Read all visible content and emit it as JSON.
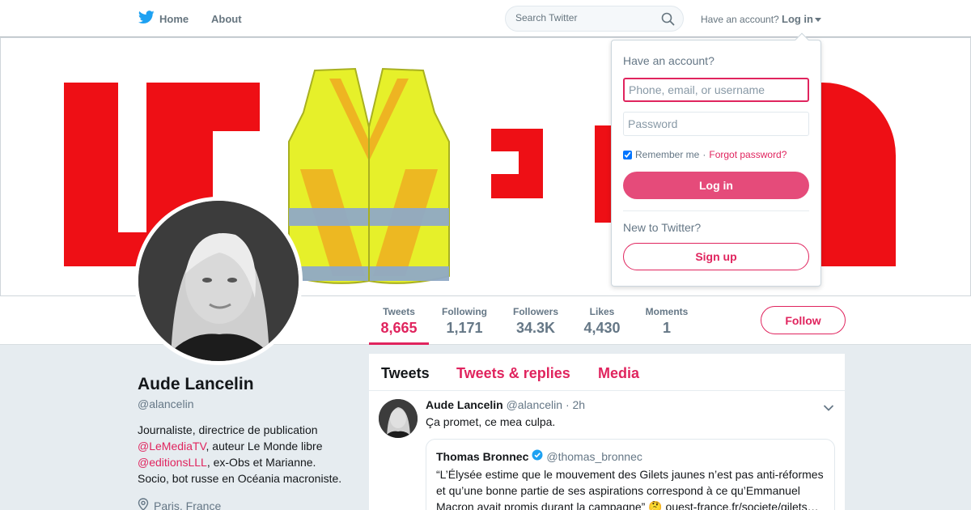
{
  "nav": {
    "home_label": "Home",
    "about_label": "About",
    "search_placeholder": "Search Twitter",
    "have_account": "Have an account?",
    "login_label": "Log in",
    "brand_color": "#1da1f2"
  },
  "login_dropdown": {
    "title": "Have an account?",
    "username_placeholder": "Phone, email, or username",
    "password_placeholder": "Password",
    "remember_label": "Remember me",
    "separator": "·",
    "forgot_label": "Forgot password?",
    "login_button": "Log in",
    "new_label": "New to Twitter?",
    "signup_button": "Sign up",
    "remember_checked": true
  },
  "stats": [
    {
      "label": "Tweets",
      "value": "8,665"
    },
    {
      "label": "Following",
      "value": "1,171"
    },
    {
      "label": "Followers",
      "value": "34.3K"
    },
    {
      "label": "Likes",
      "value": "4,430"
    },
    {
      "label": "Moments",
      "value": "1"
    }
  ],
  "follow_button": "Follow",
  "profile": {
    "name": "Aude Lancelin",
    "handle": "@alancelin",
    "bio_1": "Journaliste, directrice de publication",
    "bio_link_1": "@LeMediaTV",
    "bio_2": ", auteur Le Monde libre",
    "bio_link_2": "@editionsLLL",
    "bio_3": ", ex-Obs et Marianne.",
    "bio_4": "Socio, bot russe en Océania macroniste.",
    "location": "Paris, France"
  },
  "timeline": {
    "tabs": [
      "Tweets",
      "Tweets & replies",
      "Media"
    ],
    "tweet": {
      "author": "Aude Lancelin",
      "handle": "@alancelin",
      "time": "· 2h",
      "text": "Ça promet, ce mea culpa.",
      "quote": {
        "author": "Thomas Bronnec",
        "handle": "@thomas_bronnec",
        "text": "“L’Élysée estime que le mouvement des Gilets jaunes n’est pas anti-réformes et qu’une bonne partie de ses aspirations correspond à ce qu’Emmanuel Macron avait promis durant la campagne” 🤔 ouest-france.fr/societe/gilets…"
      }
    }
  },
  "colors": {
    "accent": "#e0245e",
    "banner_red": "#ee0f15",
    "vest_yellow": "#e6f02a",
    "vest_orange": "#f0a020",
    "vest_stripe": "#8fa9c6"
  }
}
